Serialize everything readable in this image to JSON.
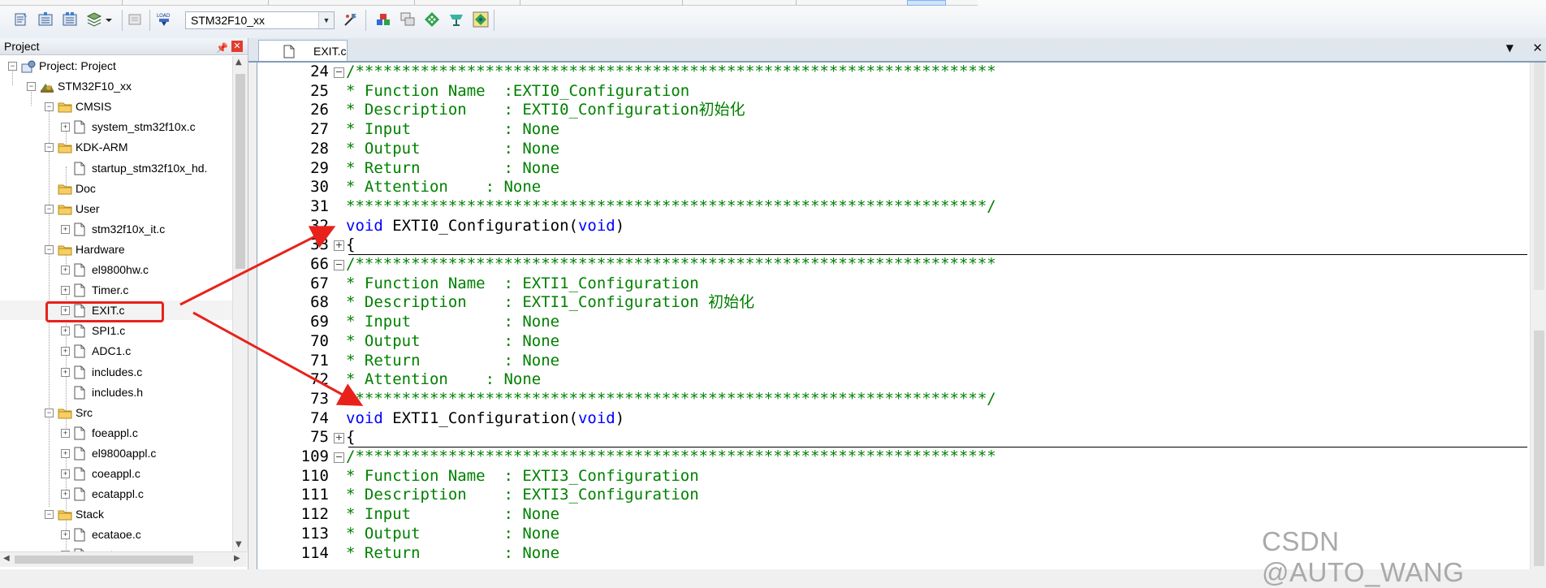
{
  "toolbar": {
    "target_name": "STM32F10_xx",
    "icons": [
      "translate-icon",
      "build-icon",
      "rebuild-icon",
      "batch-build-icon",
      "dropdown-arrow-icon",
      "stop-build-icon",
      "download-icon",
      "target-options-icon",
      "manage-components-icon",
      "file-extensions-icon",
      "pack-installer-icon",
      "software-packs-icon",
      "select-packs-icon"
    ]
  },
  "project_panel": {
    "title": "Project",
    "tree": [
      {
        "label": "Project: Project",
        "level": 0,
        "expander": "minus",
        "icon": "project"
      },
      {
        "label": "STM32F10_xx",
        "level": 1,
        "expander": "minus",
        "icon": "target"
      },
      {
        "label": "CMSIS",
        "level": 2,
        "expander": "minus",
        "icon": "folder"
      },
      {
        "label": "system_stm32f10x.c",
        "level": 3,
        "expander": "plus",
        "icon": "file"
      },
      {
        "label": "KDK-ARM",
        "level": 2,
        "expander": "minus",
        "icon": "folder"
      },
      {
        "label": "startup_stm32f10x_hd.",
        "level": 3,
        "expander": "none",
        "icon": "file"
      },
      {
        "label": "Doc",
        "level": 2,
        "expander": "none",
        "icon": "folder"
      },
      {
        "label": "User",
        "level": 2,
        "expander": "minus",
        "icon": "folder"
      },
      {
        "label": "stm32f10x_it.c",
        "level": 3,
        "expander": "plus",
        "icon": "file"
      },
      {
        "label": "Hardware",
        "level": 2,
        "expander": "minus",
        "icon": "folder"
      },
      {
        "label": "el9800hw.c",
        "level": 3,
        "expander": "plus",
        "icon": "file"
      },
      {
        "label": "Timer.c",
        "level": 3,
        "expander": "plus",
        "icon": "file"
      },
      {
        "label": "EXIT.c",
        "level": 3,
        "expander": "plus",
        "icon": "file",
        "selected": true
      },
      {
        "label": "SPI1.c",
        "level": 3,
        "expander": "plus",
        "icon": "file"
      },
      {
        "label": "ADC1.c",
        "level": 3,
        "expander": "plus",
        "icon": "file"
      },
      {
        "label": "includes.c",
        "level": 3,
        "expander": "plus",
        "icon": "file"
      },
      {
        "label": "includes.h",
        "level": 3,
        "expander": "none",
        "icon": "file"
      },
      {
        "label": "Src",
        "level": 2,
        "expander": "minus",
        "icon": "folder"
      },
      {
        "label": "foeappl.c",
        "level": 3,
        "expander": "plus",
        "icon": "file"
      },
      {
        "label": "el9800appl.c",
        "level": 3,
        "expander": "plus",
        "icon": "file"
      },
      {
        "label": "coeappl.c",
        "level": 3,
        "expander": "plus",
        "icon": "file"
      },
      {
        "label": "ecatappl.c",
        "level": 3,
        "expander": "plus",
        "icon": "file"
      },
      {
        "label": "Stack",
        "level": 2,
        "expander": "minus",
        "icon": "folder"
      },
      {
        "label": "ecataoe.c",
        "level": 3,
        "expander": "plus",
        "icon": "file"
      },
      {
        "label": "ecatcoe.c",
        "level": 3,
        "expander": "plus",
        "icon": "file"
      }
    ]
  },
  "editor": {
    "tab_label": "EXIT.c",
    "lines": [
      {
        "num": "24",
        "fold": "minus",
        "kind": "comment",
        "text": "/*********************************************************************"
      },
      {
        "num": "25",
        "fold": "",
        "kind": "comment",
        "text": "* Function Name  :EXTI0_Configuration"
      },
      {
        "num": "26",
        "fold": "",
        "kind": "comment",
        "text": "* Description    : EXTI0_Configuration初始化"
      },
      {
        "num": "27",
        "fold": "",
        "kind": "comment",
        "text": "* Input          : None"
      },
      {
        "num": "28",
        "fold": "",
        "kind": "comment",
        "text": "* Output         : None"
      },
      {
        "num": "29",
        "fold": "",
        "kind": "comment",
        "text": "* Return         : None"
      },
      {
        "num": "30",
        "fold": "",
        "kind": "comment",
        "text": "* Attention    : None"
      },
      {
        "num": "31",
        "fold": "",
        "kind": "comment",
        "text": "*********************************************************************/"
      },
      {
        "num": "32",
        "fold": "",
        "kind": "code",
        "kw1": "void",
        "mid": " EXTI0_Configuration(",
        "kw2": "void",
        "end": ")"
      },
      {
        "num": "33",
        "fold": "plus",
        "kind": "brace",
        "text": "{"
      },
      {
        "num": "66",
        "fold": "minus",
        "kind": "comment",
        "text": "/*********************************************************************"
      },
      {
        "num": "67",
        "fold": "",
        "kind": "comment",
        "text": "* Function Name  : EXTI1_Configuration"
      },
      {
        "num": "68",
        "fold": "",
        "kind": "comment",
        "text": "* Description    : EXTI1_Configuration 初始化"
      },
      {
        "num": "69",
        "fold": "",
        "kind": "comment",
        "text": "* Input          : None"
      },
      {
        "num": "70",
        "fold": "",
        "kind": "comment",
        "text": "* Output         : None"
      },
      {
        "num": "71",
        "fold": "",
        "kind": "comment",
        "text": "* Return         : None"
      },
      {
        "num": "72",
        "fold": "",
        "kind": "comment",
        "text": "* Attention    : None"
      },
      {
        "num": "73",
        "fold": "",
        "kind": "comment",
        "text": "*********************************************************************/"
      },
      {
        "num": "74",
        "fold": "",
        "kind": "code",
        "kw1": "void",
        "mid": " EXTI1_Configuration(",
        "kw2": "void",
        "end": ")"
      },
      {
        "num": "75",
        "fold": "plus",
        "kind": "brace",
        "text": "{"
      },
      {
        "num": "109",
        "fold": "minus",
        "kind": "comment",
        "text": "/*********************************************************************"
      },
      {
        "num": "110",
        "fold": "",
        "kind": "comment",
        "text": "* Function Name  : EXTI3_Configuration"
      },
      {
        "num": "111",
        "fold": "",
        "kind": "comment",
        "text": "* Description    : EXTI3_Configuration"
      },
      {
        "num": "112",
        "fold": "",
        "kind": "comment",
        "text": "* Input          : None"
      },
      {
        "num": "113",
        "fold": "",
        "kind": "comment",
        "text": "* Output         : None"
      },
      {
        "num": "114",
        "fold": "",
        "kind": "comment",
        "text": "* Return         : None"
      }
    ]
  },
  "colors": {
    "comment": "#008000",
    "keyword": "#0000ff",
    "annotation": "#e8221b"
  },
  "watermark": "CSDN @AUTO_WANG"
}
